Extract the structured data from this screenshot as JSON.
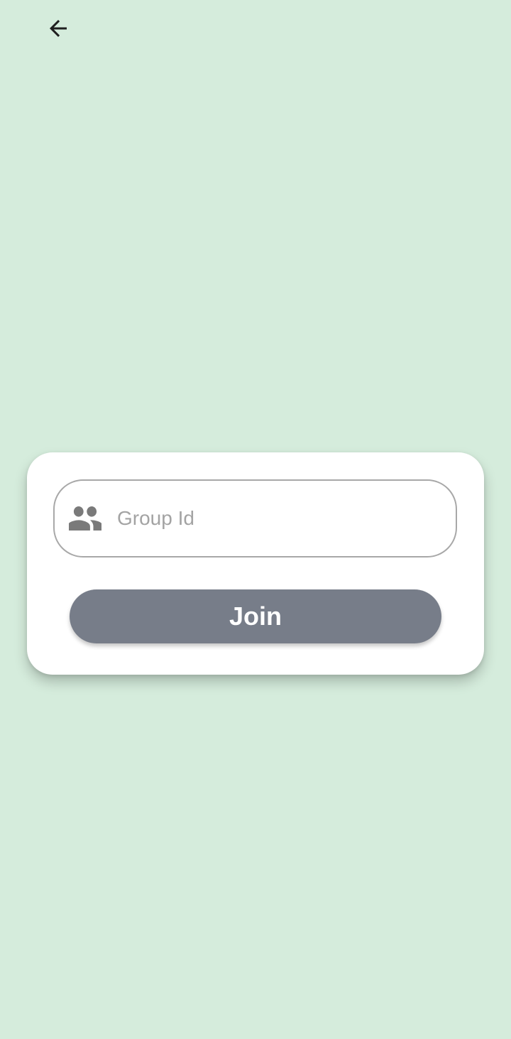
{
  "header": {
    "back_icon": "arrow-back-icon"
  },
  "join_card": {
    "group_id_field": {
      "icon": "group-icon",
      "placeholder": "Group Id",
      "value": ""
    },
    "join_button": {
      "label": "Join"
    }
  },
  "colors": {
    "background": "#d5ecdc",
    "card": "#ffffff",
    "button": "#777d89",
    "input_border": "#a8a8a8",
    "placeholder": "#a3a3a3"
  }
}
